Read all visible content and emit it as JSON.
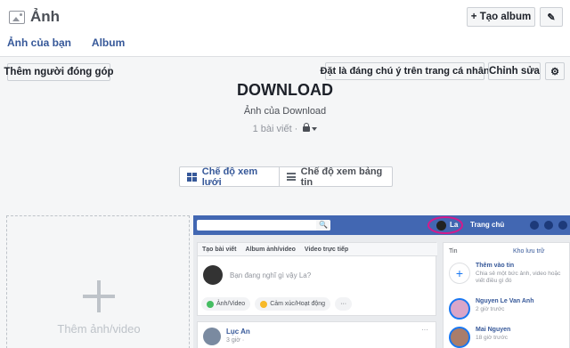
{
  "header": {
    "title": "Ảnh",
    "create_album_label": "+ Tạo album",
    "edit_icon_glyph": "✎",
    "tabs": [
      "Ảnh của bạn",
      "Album"
    ]
  },
  "actions": {
    "add_contributors": "Thêm người đóng góp",
    "feature_on_profile": "Đặt là đáng chú ý trên trang cá nhân",
    "edit_album": "Chỉnh sửa",
    "gear_glyph": "⚙"
  },
  "album": {
    "title": "DOWNLOAD",
    "owner": "Ảnh của Download",
    "post_count": "1 bài viết ·"
  },
  "view_toggle": {
    "grid_label": "Chế độ xem lưới",
    "feed_label": "Chế độ xem bảng tin",
    "active": "grid"
  },
  "add_photo": {
    "label": "Thêm ảnh/video"
  },
  "photo": {
    "top_user": "La",
    "top_home": "Trang chủ",
    "search_glyph": "🔍",
    "composer_tabs": [
      "Tạo bài viết",
      "Album ảnh/video",
      "Video trực tiếp"
    ],
    "prompt": "Bạn đang nghĩ gì vậy La?",
    "action_photo": "Ảnh/Video",
    "action_feeling": "Cảm xúc/Hoạt động",
    "action_more": "···",
    "post_author": "Lục An",
    "post_time": "3 giờ ·",
    "post_dots": "···",
    "stories_title": "Tin",
    "stories_link": "Kho lưu trữ",
    "stories": [
      {
        "name": "Thêm vào tin",
        "sub": "Chia sẻ một bức ảnh, video hoặc viết điều gì đó"
      },
      {
        "name": "Nguyen Le Van Anh",
        "sub": "2 giờ trước"
      },
      {
        "name": "Mai Nguyen",
        "sub": "18 giờ trước"
      }
    ]
  },
  "colors": {
    "facebook_blue": "#4267b2",
    "link_blue": "#365899",
    "highlight_ring": "#d41a8b"
  }
}
